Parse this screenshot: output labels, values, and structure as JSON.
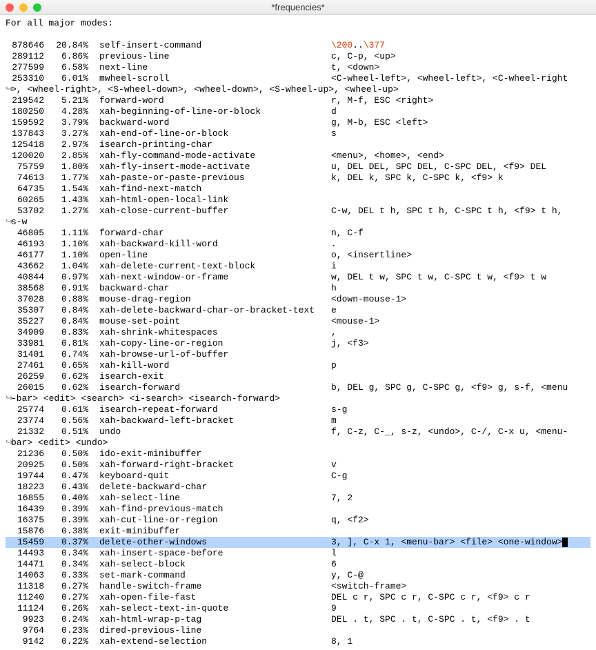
{
  "window": {
    "title": "*frequencies*"
  },
  "header": "For all major modes:",
  "escape_seq": {
    "pre": "\\200",
    "mid": "..",
    "post": "\\377"
  },
  "rows": [
    {
      "count": "878646",
      "pct": "20.84%",
      "cmd": "self-insert-command",
      "keys": "",
      "special": "escape"
    },
    {
      "count": "289112",
      "pct": "6.86%",
      "cmd": "previous-line",
      "keys": "c, C-p, <up>"
    },
    {
      "count": "277599",
      "pct": "6.58%",
      "cmd": "next-line",
      "keys": "t, <down>"
    },
    {
      "count": "253310",
      "pct": "6.01%",
      "cmd": "mwheel-scroll",
      "keys": "<C-wheel-left>, <wheel-left>, <C-wheel-right"
    },
    {
      "wrap": ">, <wheel-right>, <S-wheel-down>, <wheel-down>, <S-wheel-up>, <wheel-up>"
    },
    {
      "count": "219542",
      "pct": "5.21%",
      "cmd": "forward-word",
      "keys": "r, M-f, ESC <right>"
    },
    {
      "count": "180250",
      "pct": "4.28%",
      "cmd": "xah-beginning-of-line-or-block",
      "keys": "d"
    },
    {
      "count": "159592",
      "pct": "3.79%",
      "cmd": "backward-word",
      "keys": "g, M-b, ESC <left>"
    },
    {
      "count": "137843",
      "pct": "3.27%",
      "cmd": "xah-end-of-line-or-block",
      "keys": "s"
    },
    {
      "count": "125418",
      "pct": "2.97%",
      "cmd": "isearch-printing-char",
      "keys": ""
    },
    {
      "count": "120020",
      "pct": "2.85%",
      "cmd": "xah-fly-command-mode-activate",
      "keys": "<menu>, <home>, <end>"
    },
    {
      "count": "75759",
      "pct": "1.80%",
      "cmd": "xah-fly-insert-mode-activate",
      "keys": "u, DEL DEL, SPC DEL, C-SPC DEL, <f9> DEL"
    },
    {
      "count": "74613",
      "pct": "1.77%",
      "cmd": "xah-paste-or-paste-previous",
      "keys": "k, DEL k, SPC k, C-SPC k, <f9> k"
    },
    {
      "count": "64735",
      "pct": "1.54%",
      "cmd": "xah-find-next-match",
      "keys": ""
    },
    {
      "count": "60265",
      "pct": "1.43%",
      "cmd": "xah-html-open-local-link",
      "keys": ""
    },
    {
      "count": "53702",
      "pct": "1.27%",
      "cmd": "xah-close-current-buffer",
      "keys": "C-w, DEL t h, SPC t h, C-SPC t h, <f9> t h, "
    },
    {
      "wrap": "s-w"
    },
    {
      "count": "46805",
      "pct": "1.11%",
      "cmd": "forward-char",
      "keys": "n, C-f"
    },
    {
      "count": "46193",
      "pct": "1.10%",
      "cmd": "xah-backward-kill-word",
      "keys": "."
    },
    {
      "count": "46177",
      "pct": "1.10%",
      "cmd": "open-line",
      "keys": "o, <insertline>"
    },
    {
      "count": "43662",
      "pct": "1.04%",
      "cmd": "xah-delete-current-text-block",
      "keys": "i"
    },
    {
      "count": "40844",
      "pct": "0.97%",
      "cmd": "xah-next-window-or-frame",
      "keys": "w, DEL t w, SPC t w, C-SPC t w, <f9> t w"
    },
    {
      "count": "38568",
      "pct": "0.91%",
      "cmd": "backward-char",
      "keys": "h"
    },
    {
      "count": "37028",
      "pct": "0.88%",
      "cmd": "mouse-drag-region",
      "keys": "<down-mouse-1>"
    },
    {
      "count": "35307",
      "pct": "0.84%",
      "cmd": "xah-delete-backward-char-or-bracket-text",
      "keys": "e"
    },
    {
      "count": "35227",
      "pct": "0.84%",
      "cmd": "mouse-set-point",
      "keys": "<mouse-1>"
    },
    {
      "count": "34909",
      "pct": "0.83%",
      "cmd": "xah-shrink-whitespaces",
      "keys": ","
    },
    {
      "count": "33981",
      "pct": "0.81%",
      "cmd": "xah-copy-line-or-region",
      "keys": "j, <f3>"
    },
    {
      "count": "31401",
      "pct": "0.74%",
      "cmd": "xah-browse-url-of-buffer",
      "keys": ""
    },
    {
      "count": "27461",
      "pct": "0.65%",
      "cmd": "xah-kill-word",
      "keys": "p"
    },
    {
      "count": "26259",
      "pct": "0.62%",
      "cmd": "isearch-exit",
      "keys": ""
    },
    {
      "count": "26015",
      "pct": "0.62%",
      "cmd": "isearch-forward",
      "keys": "b, DEL g, SPC g, C-SPC g, <f9> g, s-f, <menu"
    },
    {
      "wrap": "-bar> <edit> <search> <i-search> <isearch-forward>"
    },
    {
      "count": "25774",
      "pct": "0.61%",
      "cmd": "isearch-repeat-forward",
      "keys": "s-g"
    },
    {
      "count": "23774",
      "pct": "0.56%",
      "cmd": "xah-backward-left-bracket",
      "keys": "m"
    },
    {
      "count": "21332",
      "pct": "0.51%",
      "cmd": "undo",
      "keys": "f, C-z, C-_, s-z, <undo>, C-/, C-x u, <menu-"
    },
    {
      "wrap": "bar> <edit> <undo>"
    },
    {
      "count": "21236",
      "pct": "0.50%",
      "cmd": "ido-exit-minibuffer",
      "keys": ""
    },
    {
      "count": "20925",
      "pct": "0.50%",
      "cmd": "xah-forward-right-bracket",
      "keys": "v"
    },
    {
      "count": "19744",
      "pct": "0.47%",
      "cmd": "keyboard-quit",
      "keys": "C-g"
    },
    {
      "count": "18223",
      "pct": "0.43%",
      "cmd": "delete-backward-char",
      "keys": ""
    },
    {
      "count": "16855",
      "pct": "0.40%",
      "cmd": "xah-select-line",
      "keys": "7, 2"
    },
    {
      "count": "16439",
      "pct": "0.39%",
      "cmd": "xah-find-previous-match",
      "keys": ""
    },
    {
      "count": "16375",
      "pct": "0.39%",
      "cmd": "xah-cut-line-or-region",
      "keys": "q, <f2>"
    },
    {
      "count": "15876",
      "pct": "0.38%",
      "cmd": "exit-minibuffer",
      "keys": ""
    },
    {
      "count": "15459",
      "pct": "0.37%",
      "cmd": "delete-other-windows",
      "keys": "3, ], C-x 1, <menu-bar> <file> <one-window>",
      "highlight": true,
      "cursor": true
    },
    {
      "count": "14493",
      "pct": "0.34%",
      "cmd": "xah-insert-space-before",
      "keys": "l"
    },
    {
      "count": "14471",
      "pct": "0.34%",
      "cmd": "xah-select-block",
      "keys": "6"
    },
    {
      "count": "14063",
      "pct": "0.33%",
      "cmd": "set-mark-command",
      "keys": "y, C-@"
    },
    {
      "count": "11318",
      "pct": "0.27%",
      "cmd": "handle-switch-frame",
      "keys": "<switch-frame>"
    },
    {
      "count": "11240",
      "pct": "0.27%",
      "cmd": "xah-open-file-fast",
      "keys": "DEL c r, SPC c r, C-SPC c r, <f9> c r"
    },
    {
      "count": "11124",
      "pct": "0.26%",
      "cmd": "xah-select-text-in-quote",
      "keys": "9"
    },
    {
      "count": "9923",
      "pct": "0.24%",
      "cmd": "xah-html-wrap-p-tag",
      "keys": "DEL . t, SPC . t, C-SPC . t, <f9> . t"
    },
    {
      "count": "9764",
      "pct": "0.23%",
      "cmd": "dired-previous-line",
      "keys": ""
    },
    {
      "count": "9142",
      "pct": "0.22%",
      "cmd": "xah-extend-selection",
      "keys": "8, 1"
    }
  ]
}
